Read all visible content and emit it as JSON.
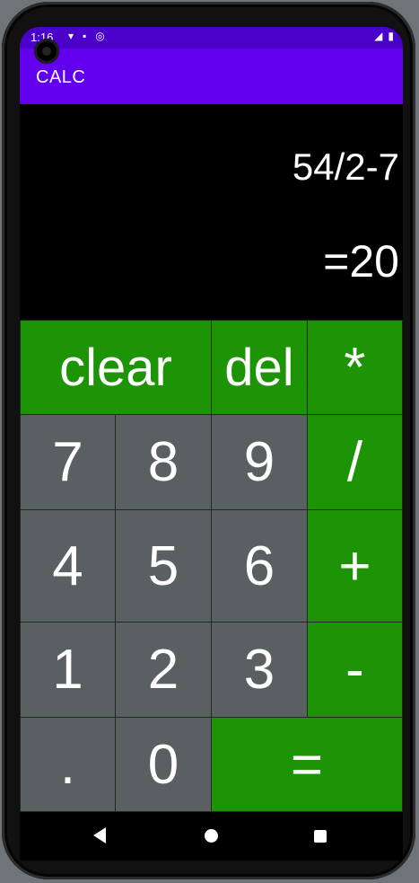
{
  "status_bar": {
    "time": "1:16",
    "left_icons": [
      "wifi-icon",
      "sd-card-icon",
      "sync-icon"
    ],
    "right_icons": [
      "signal-icon",
      "battery-icon"
    ]
  },
  "app_bar": {
    "title": "CALC"
  },
  "display": {
    "expression": "54/2-7",
    "result": "=20"
  },
  "keys": {
    "clear": "clear",
    "del": "del",
    "multiply": "*",
    "seven": "7",
    "eight": "8",
    "nine": "9",
    "divide": "/",
    "four": "4",
    "five": "5",
    "six": "6",
    "plus": "+",
    "one": "1",
    "two": "2",
    "three": "3",
    "minus": "-",
    "dot": ".",
    "zero": "0",
    "equals": "="
  },
  "colors": {
    "status_bar": "#4b00c9",
    "app_bar": "#6200ee",
    "operator_key": "#1c9406",
    "digit_key": "#5a5f61",
    "display_bg": "#000000"
  },
  "navigation": [
    "back-icon",
    "home-icon",
    "recents-icon"
  ]
}
